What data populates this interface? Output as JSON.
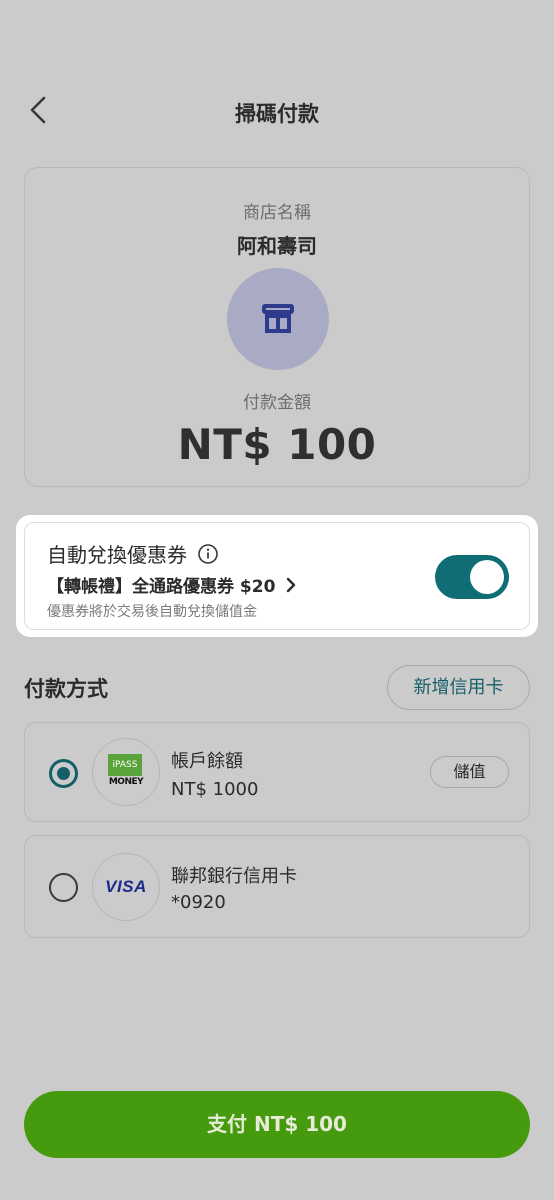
{
  "header": {
    "title": "掃碼付款",
    "back_icon": "chevron-left-icon"
  },
  "merchant": {
    "label": "商店名稱",
    "name": "阿和壽司",
    "icon": "store-icon",
    "amount_label": "付款金額",
    "amount": "NT$ 100"
  },
  "coupon": {
    "title": "自動兌換優惠券",
    "info_icon": "info-icon",
    "offer": "【轉帳禮】全通路優惠券 $20",
    "note": "優惠券將於交易後自動兌換儲值金",
    "toggle_on": true
  },
  "payment": {
    "section_title": "付款方式",
    "add_card_label": "新增信用卡",
    "methods": [
      {
        "name": "帳戶餘額",
        "sub": "NT$ 1000",
        "logo_top": "iPASS",
        "logo_bottom": "MONEY",
        "action_label": "儲值",
        "selected": true
      },
      {
        "name": "聯邦銀行信用卡",
        "sub": "*0920",
        "logo": "VISA",
        "selected": false
      }
    ]
  },
  "pay_button": {
    "label": "支付 NT$ 100"
  },
  "colors": {
    "background": "#cbcbcb",
    "accent_teal": "#106d76",
    "pay_green": "#459a0d",
    "store_avatar": "#a9abc4",
    "store_icon": "#2e3a8c"
  }
}
